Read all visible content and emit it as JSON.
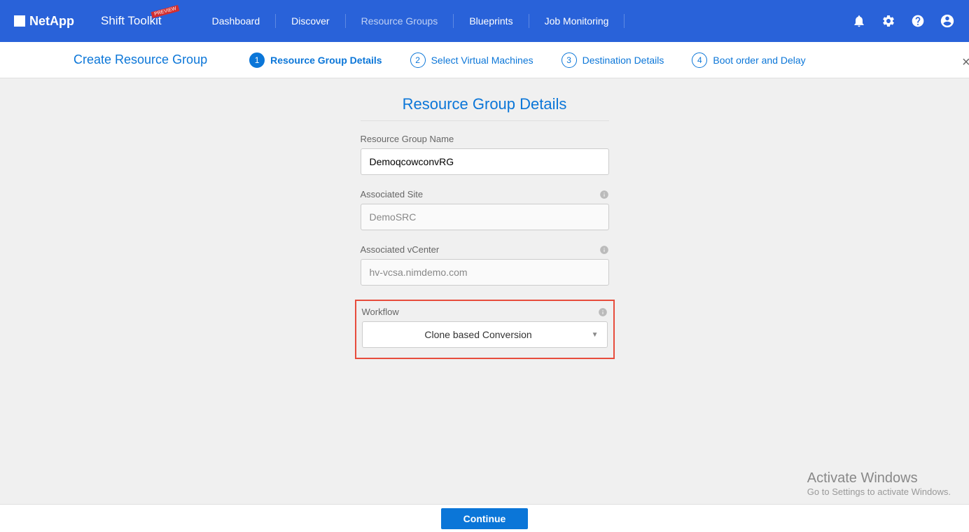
{
  "header": {
    "brand": "NetApp",
    "product": "Shift Toolkit",
    "badge": "PREVIEW",
    "nav": {
      "dashboard": "Dashboard",
      "discover": "Discover",
      "resource_groups": "Resource Groups",
      "blueprints": "Blueprints",
      "job_monitoring": "Job Monitoring"
    }
  },
  "subheader": {
    "title": "Create Resource Group",
    "steps": [
      {
        "num": "1",
        "label": "Resource Group Details"
      },
      {
        "num": "2",
        "label": "Select Virtual Machines"
      },
      {
        "num": "3",
        "label": "Destination Details"
      },
      {
        "num": "4",
        "label": "Boot order and Delay"
      }
    ]
  },
  "form": {
    "title": "Resource Group Details",
    "rg_name_label": "Resource Group Name",
    "rg_name_value": "DemoqcowconvRG",
    "site_label": "Associated Site",
    "site_value": "DemoSRC",
    "vcenter_label": "Associated vCenter",
    "vcenter_value": "hv-vcsa.nimdemo.com",
    "workflow_label": "Workflow",
    "workflow_value": "Clone based Conversion"
  },
  "footer": {
    "continue": "Continue"
  },
  "watermark": {
    "title": "Activate Windows",
    "sub": "Go to Settings to activate Windows."
  }
}
